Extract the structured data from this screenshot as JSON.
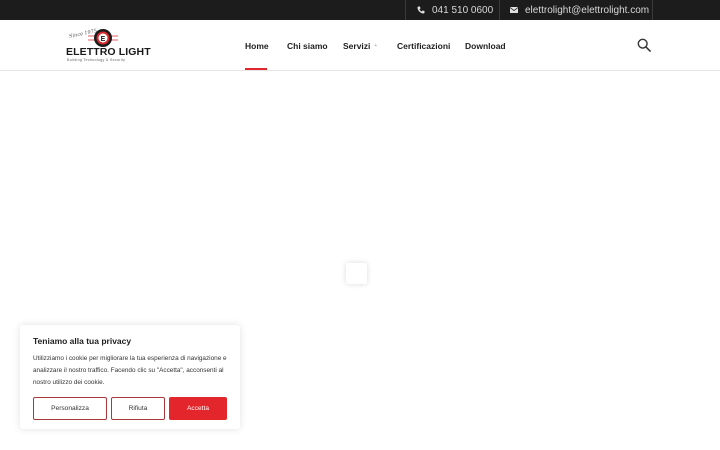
{
  "topbar": {
    "phone": "041 510 0600",
    "phone_icon": "phone-icon",
    "email": "elettrolight@elettrolight.com",
    "email_icon": "envelope-icon"
  },
  "logo": {
    "since": "Since 1975",
    "name": "ELETTRO LIGHT",
    "tagline": "Building Technology & Security"
  },
  "nav": {
    "items": [
      {
        "label": "Home",
        "active": true
      },
      {
        "label": "Chi siamo"
      },
      {
        "label": "Servizi",
        "has_submenu": true
      },
      {
        "label": "Certificazioni"
      },
      {
        "label": "Download"
      }
    ],
    "submenu_caret": "+",
    "search_icon": "search-icon"
  },
  "cookie": {
    "title": "Teniamo alla tua privacy",
    "body": "Utilizziamo i cookie per migliorare la tua esperienza di navigazione e analizzare il nostro traffico. Facendo clic su \"Accetta\", acconsenti al nostro utilizzo dei cookie.",
    "buttons": {
      "customize": "Personalizza",
      "reject": "Rifiuta",
      "accept": "Accetta"
    }
  },
  "colors": {
    "accent": "#e3262b",
    "topbar_bg": "#1c1c1c"
  }
}
